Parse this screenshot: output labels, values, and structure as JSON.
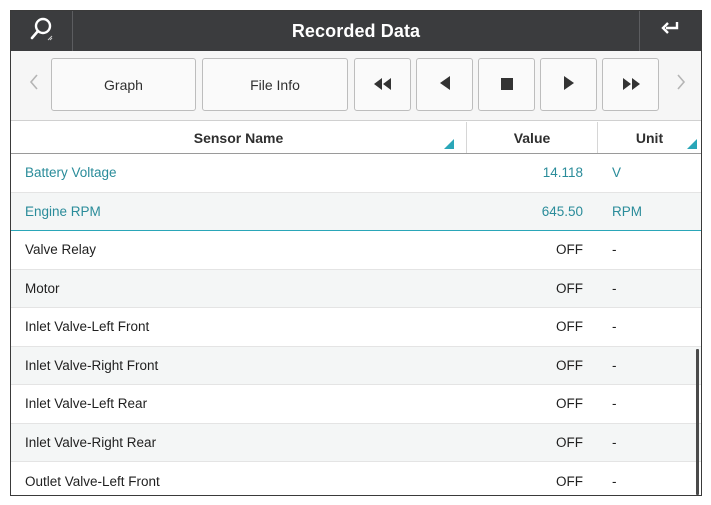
{
  "header": {
    "title": "Recorded Data",
    "left_icon": "search-icon",
    "right_icon": "return-icon"
  },
  "toolbar": {
    "graph_label": "Graph",
    "file_info_label": "File Info",
    "buttons": [
      "rewind-icon",
      "step-back-icon",
      "stop-icon",
      "play-icon",
      "fast-forward-icon"
    ]
  },
  "table": {
    "columns": {
      "name": "Sensor Name",
      "value": "Value",
      "unit": "Unit"
    },
    "rows": [
      {
        "name": "Battery Voltage",
        "value": "14.118",
        "unit": "V"
      },
      {
        "name": "Engine RPM",
        "value": "645.50",
        "unit": "RPM"
      },
      {
        "name": "Valve Relay",
        "value": "OFF",
        "unit": "-"
      },
      {
        "name": "Motor",
        "value": "OFF",
        "unit": "-"
      },
      {
        "name": "Inlet Valve-Left Front",
        "value": "OFF",
        "unit": "-"
      },
      {
        "name": "Inlet Valve-Right Front",
        "value": "OFF",
        "unit": "-"
      },
      {
        "name": "Inlet Valve-Left Rear",
        "value": "OFF",
        "unit": "-"
      },
      {
        "name": "Inlet Valve-Right Rear",
        "value": "OFF",
        "unit": "-"
      },
      {
        "name": "Outlet Valve-Left Front",
        "value": "OFF",
        "unit": "-"
      }
    ]
  },
  "colors": {
    "titlebar": "#3b3c3e",
    "accent": "#2aa6b8",
    "highlight_text": "#2a8c9a"
  }
}
